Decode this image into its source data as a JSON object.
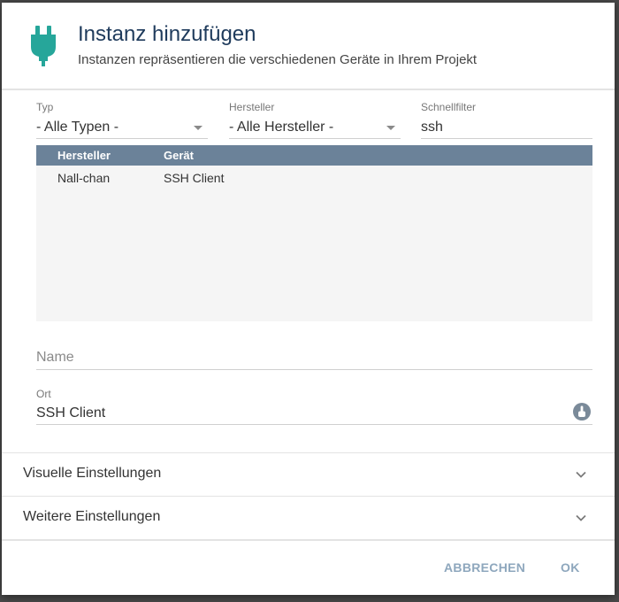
{
  "dialog": {
    "title": "Instanz hinzufügen",
    "subtitle": "Instanzen repräsentieren die verschiedenen Geräte in Ihrem Projekt",
    "icon": "plug-icon",
    "accent_color": "#26a69a"
  },
  "filters": {
    "typ": {
      "label": "Typ",
      "value": "- Alle Typen -"
    },
    "hersteller": {
      "label": "Hersteller",
      "value": "- Alle Hersteller -"
    },
    "schnellfilter": {
      "label": "Schnellfilter",
      "value": "ssh"
    }
  },
  "table": {
    "header_color": "#6b8299",
    "columns": [
      "Hersteller",
      "Gerät"
    ],
    "rows": [
      {
        "hersteller": "Nall-chan",
        "geraet": "SSH Client"
      }
    ]
  },
  "form": {
    "name": {
      "placeholder": "Name",
      "value": ""
    },
    "ort": {
      "label": "Ort",
      "value": "SSH Client",
      "button_icon": "location-icon"
    }
  },
  "sections": [
    {
      "label": "Visuelle Einstellungen",
      "icon": "chevron-down-icon"
    },
    {
      "label": "Weitere Einstellungen",
      "icon": "chevron-down-icon"
    }
  ],
  "buttons": {
    "cancel": "ABBRECHEN",
    "ok": "OK",
    "color": "#8ea7bd"
  }
}
